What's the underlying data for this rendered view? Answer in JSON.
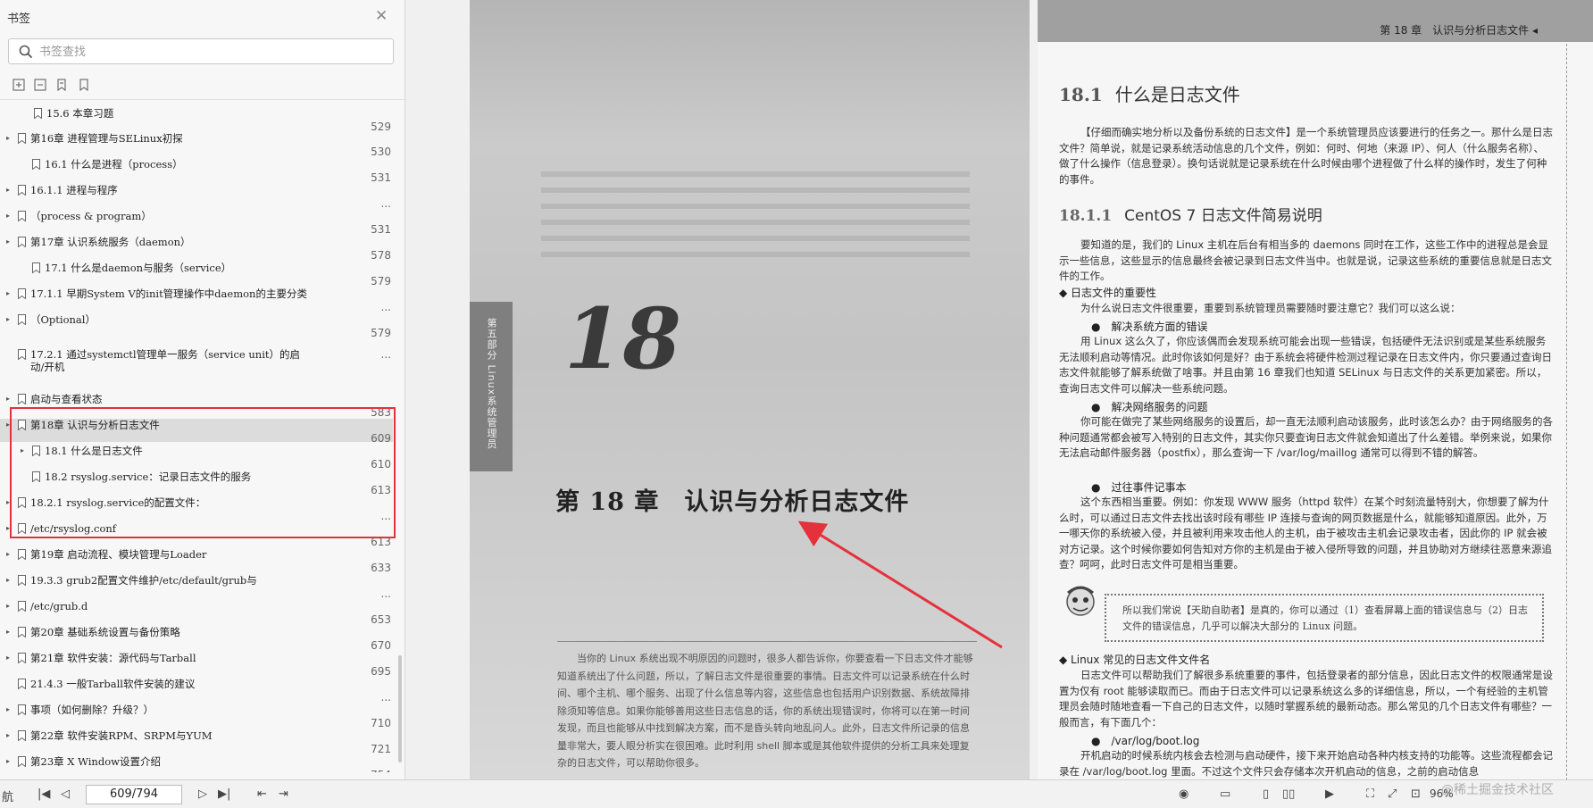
{
  "sidebar": {
    "title": "书签",
    "search_placeholder": "书签查找",
    "bookmarks": [
      {
        "text": "15.6 本章习题",
        "page": "529"
      },
      {
        "text": "第16章 进程管理与SELinux初探",
        "page": "530"
      },
      {
        "text": "16.1 什么是进程（process）",
        "page": "531"
      },
      {
        "text": "16.1.1 进程与程序",
        "page": "..."
      },
      {
        "text": "（process & program）",
        "page": "531"
      },
      {
        "text": "第17章 认识系统服务（daemon）",
        "page": "578"
      },
      {
        "text": "17.1 什么是daemon与服务（service）",
        "page": "579"
      },
      {
        "text": "17.1.1 早期System V的init管理操作中daemon的主要分类",
        "page": "..."
      },
      {
        "text": "（Optional）",
        "page": "579"
      },
      {
        "text": "17.2.1 通过systemctl管理单一服务（service unit）的启动/开机",
        "page": "..."
      },
      {
        "text": "启动与查看状态",
        "page": "583"
      },
      {
        "text": "第18章 认识与分析日志文件",
        "page": "609"
      },
      {
        "text": "18.1 什么是日志文件",
        "page": "610"
      },
      {
        "text": "18.2 rsyslog.service：记录日志文件的服务",
        "page": "613"
      },
      {
        "text": "18.2.1 rsyslog.service的配置文件：",
        "page": "..."
      },
      {
        "text": "/etc/rsyslog.conf",
        "page": "613"
      },
      {
        "text": "第19章 启动流程、模块管理与Loader",
        "page": "633"
      },
      {
        "text": "19.3.3 grub2配置文件维护/etc/default/grub与",
        "page": "..."
      },
      {
        "text": "/etc/grub.d",
        "page": "653"
      },
      {
        "text": "第20章 基础系统设置与备份策略",
        "page": "670"
      },
      {
        "text": "第21章 软件安装：源代码与Tarball",
        "page": "695"
      },
      {
        "text": "21.4.3 一般Tarball软件安装的建议",
        "page": "..."
      },
      {
        "text": "事项（如何删除？升级？）",
        "page": "710"
      },
      {
        "text": "第22章 软件安装RPM、SRPM与YUM",
        "page": "721"
      },
      {
        "text": "第23章 X Window设置介绍",
        "page": "754"
      }
    ]
  },
  "bottom": {
    "nav_label": "航",
    "page_indicator": "609/794",
    "zoom": "96%",
    "watermark": "@稀土掘金技术社区"
  },
  "doc": {
    "left_page": {
      "part_label": "第五部分  Linux系统管理员",
      "chapter_number": "18",
      "chapter_title": "第 18 章　认识与分析日志文件",
      "intro": "当你的 Linux 系统出现不明原因的问题时，很多人都告诉你，你要查看一下日志文件才能够知道系统出了什么问题，所以，了解日志文件是很重要的事情。日志文件可以记录系统在什么时间、哪个主机、哪个服务、出现了什么信息等内容，这些信息也包括用户识别数据、系统故障排除须知等信息。如果你能够善用这些日志信息的话，你的系统出现错误时，你将可以在第一时间发现，而且也能够从中找到解决方案，而不是昏头转向地乱问人。此外，日志文件所记录的信息量非常大，要人眼分析实在很困难。此时利用 shell 脚本或是其他软件提供的分析工具来处理复杂的日志文件，可以帮助你很多。"
    },
    "right_page": {
      "header": "第 18 章　认识与分析日志文件 ◂",
      "h1_num": "18.1",
      "h1_text": "什么是日志文件",
      "p1": "【仔细而确实地分析以及备份系统的日志文件】是一个系统管理员应该要进行的任务之一。那什么是日志文件？简单说，就是记录系统活动信息的几个文件，例如：何时、何地（来源 IP）、何人（什么服务名称）、做了什么操作（信息登录）。换句话说就是记录系统在什么时候由哪个进程做了什么样的操作时，发生了何种的事件。",
      "h2_num": "18.1.1",
      "h2_text": "CentOS 7 日志文件简易说明",
      "p2": "要知道的是，我们的 Linux 主机在后台有相当多的 daemons 同时在工作，这些工作中的进程总是会显示一些信息，这些显示的信息最终会被记录到日志文件当中。也就是说，记录这些系统的重要信息就是日志文件的工作。",
      "b1": "◆ 日志文件的重要性",
      "p3": "为什么说日志文件很重要，重要到系统管理员需要随时要注意它？我们可以这么说：",
      "s1": "●　解决系统方面的错误",
      "p4": "用 Linux 这么久了，你应该偶而会发现系统可能会出现一些错误，包括硬件无法识别或是某些系统服务无法顺利启动等情况。此时你该如何是好？由于系统会将硬件检测过程记录在日志文件内，你只要通过查询日志文件就能够了解系统做了啥事。并且由第 16 章我们也知道 SELinux 与日志文件的关系更加紧密。所以，查询日志文件可以解决一些系统问题。",
      "s2": "●　解决网络服务的问题",
      "p5": "你可能在做完了某些网络服务的设置后，却一直无法顺利启动该服务，此时该怎么办？由于网络服务的各种问题通常都会被写入特别的日志文件，其实你只要查询日志文件就会知道出了什么差错。举例来说，如果你无法启动邮件服务器（postfix），那么查询一下 /var/log/maillog 通常可以得到不错的解答。",
      "s3": "●　过往事件记事本",
      "p6": "这个东西相当重要。例如：你发现 WWW 服务（httpd 软件）在某个时刻流量特别大，你想要了解为什么时，可以通过日志文件去找出该时段有哪些 IP 连接与查询的网页数据是什么，就能够知道原因。此外，万一哪天你的系统被入侵，并且被利用来攻击他人的主机，由于被攻击主机会记录攻击者，因此你的 IP 就会被对方记录。这个时候你要如何告知对方你的主机是由于被入侵所导致的问题，并且协助对方继续往恶意来源追查？呵呵，此时日志文件可是相当重要。",
      "tip": "所以我们常说【天助自助者】是真的，你可以通过（1）查看屏幕上面的错误信息与（2）日志文件的错误信息，几乎可以解决大部分的 Linux 问题。",
      "b2": "◆ Linux 常见的日志文件文件名",
      "p7": "日志文件可以帮助我们了解很多系统重要的事件，包括登录者的部分信息，因此日志文件的权限通常是设置为仅有 root 能够读取而已。而由于日志文件可以记录系统这么多的详细信息，所以，一个有经验的主机管理员会随时随地查看一下自己的日志文件，以随时掌握系统的最新动态。那么常见的几个日志文件有哪些？一般而言，有下面几个：",
      "s4": "●　/var/log/boot.log",
      "p8": "开机启动的时候系统内核会去检测与启动硬件，接下来开始启动各种内核支持的功能等。这些流程都会记录在 /var/log/boot.log 里面。不过这个文件只会存储本次开机启动的信息，之前的启动信息"
    }
  },
  "colors": {
    "highlight_box": "#e5313b",
    "selected_row": "#dcdcdc"
  }
}
